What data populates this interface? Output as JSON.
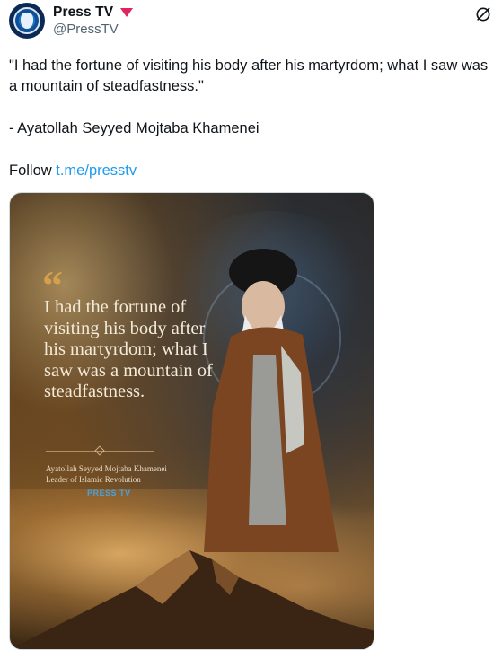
{
  "account": {
    "display_name": "Press TV",
    "handle": "@PressTV",
    "badge_color": "#e0245e",
    "avatar_icon": "presstv-logo"
  },
  "actions": {
    "grok_icon": "grok-icon"
  },
  "tweet": {
    "quote": "\"I had the fortune of visiting his body after his martyrdom; what I saw was a mountain of steadfastness.\"",
    "attribution": "- Ayatollah Seyyed Mojtaba Khamenei",
    "follow_prefix": "Follow ",
    "follow_link": "t.me/presstv",
    "link_color": "#1d9bf0"
  },
  "media": {
    "quote_mark": "“",
    "quote": "I had the fortune of visiting his body after his martyrdom; what I saw was a mountain of steadfastness.",
    "author": "Ayatollah Seyyed Mojtaba Khamenei",
    "role": "Leader of Islamic Revolution",
    "logo": "PRESS TV"
  }
}
